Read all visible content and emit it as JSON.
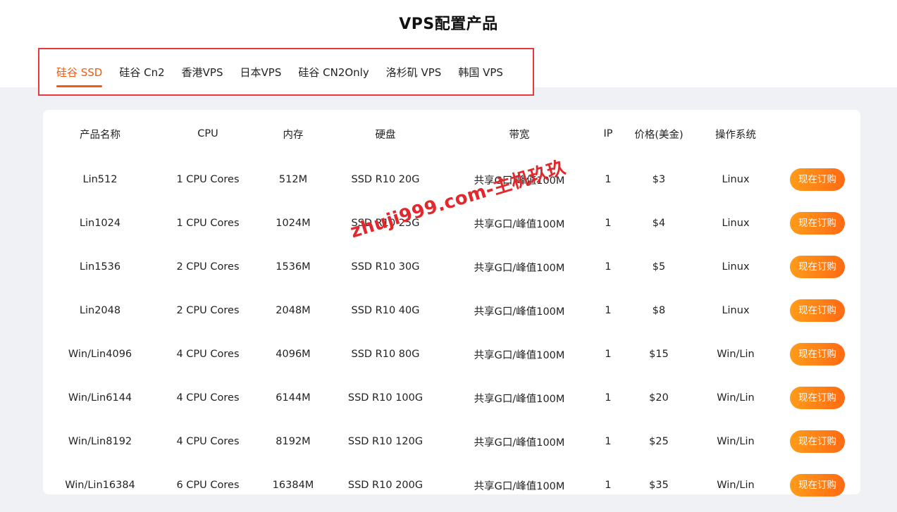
{
  "page": {
    "title": "VPS配置产品"
  },
  "tabs": [
    {
      "label": "硅谷 SSD",
      "active": true
    },
    {
      "label": "硅谷 Cn2",
      "active": false
    },
    {
      "label": "香港VPS",
      "active": false
    },
    {
      "label": "日本VPS",
      "active": false
    },
    {
      "label": "硅谷 CN2Only",
      "active": false
    },
    {
      "label": "洛杉矶 VPS",
      "active": false
    },
    {
      "label": "韩国 VPS",
      "active": false
    }
  ],
  "table": {
    "headers": [
      "产品名称",
      "CPU",
      "内存",
      "硬盘",
      "带宽",
      "IP",
      "价格(美金)",
      "操作系统",
      ""
    ],
    "order_label": "现在订购",
    "rows": [
      {
        "name": "Lin512",
        "cpu": "1 CPU Cores",
        "ram": "512M",
        "disk": "SSD R10 20G",
        "bandwidth": "共享G口/峰值100M",
        "ip": "1",
        "price": "$3",
        "os": "Linux"
      },
      {
        "name": "Lin1024",
        "cpu": "1 CPU Cores",
        "ram": "1024M",
        "disk": "SSD R10 25G",
        "bandwidth": "共享G口/峰值100M",
        "ip": "1",
        "price": "$4",
        "os": "Linux"
      },
      {
        "name": "Lin1536",
        "cpu": "2 CPU Cores",
        "ram": "1536M",
        "disk": "SSD R10 30G",
        "bandwidth": "共享G口/峰值100M",
        "ip": "1",
        "price": "$5",
        "os": "Linux"
      },
      {
        "name": "Lin2048",
        "cpu": "2 CPU Cores",
        "ram": "2048M",
        "disk": "SSD R10 40G",
        "bandwidth": "共享G口/峰值100M",
        "ip": "1",
        "price": "$8",
        "os": "Linux"
      },
      {
        "name": "Win/Lin4096",
        "cpu": "4 CPU Cores",
        "ram": "4096M",
        "disk": "SSD R10 80G",
        "bandwidth": "共享G口/峰值100M",
        "ip": "1",
        "price": "$15",
        "os": "Win/Lin"
      },
      {
        "name": "Win/Lin6144",
        "cpu": "4 CPU Cores",
        "ram": "6144M",
        "disk": "SSD R10 100G",
        "bandwidth": "共享G口/峰值100M",
        "ip": "1",
        "price": "$20",
        "os": "Win/Lin"
      },
      {
        "name": "Win/Lin8192",
        "cpu": "4 CPU Cores",
        "ram": "8192M",
        "disk": "SSD R10 120G",
        "bandwidth": "共享G口/峰值100M",
        "ip": "1",
        "price": "$25",
        "os": "Win/Lin"
      },
      {
        "name": "Win/Lin16384",
        "cpu": "6 CPU Cores",
        "ram": "16384M",
        "disk": "SSD R10 200G",
        "bandwidth": "共享G口/峰值100M",
        "ip": "1",
        "price": "$35",
        "os": "Win/Lin"
      }
    ]
  },
  "watermark": "zhuji999.com-主机玖玖",
  "colors": {
    "accent": "#ef5a14",
    "highlight_box": "#e8383d",
    "button_start": "#ff9c1a",
    "button_end": "#ff6a14",
    "page_bg": "#eff1f4"
  }
}
